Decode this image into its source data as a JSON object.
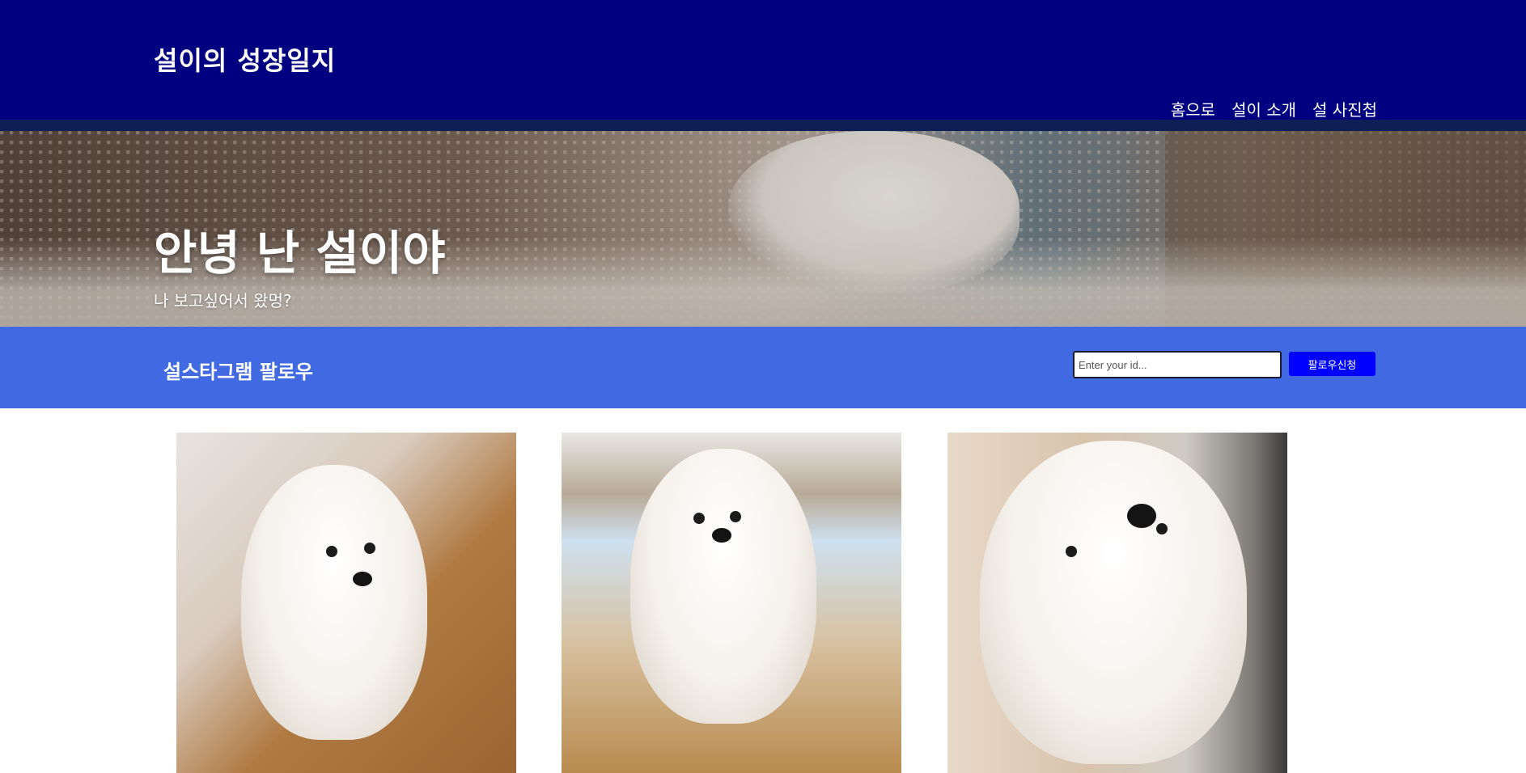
{
  "header": {
    "site_title": "설이의 성장일지",
    "nav": [
      "홈으로",
      "설이 소개",
      "설 사진첩"
    ]
  },
  "hero": {
    "title": "안녕 난 설이야",
    "subtitle": "나 보고싶어서 왔멍?"
  },
  "follow": {
    "title": "설스타그램 팔로우",
    "input_placeholder": "Enter your id...",
    "button_label": "팔로우신청"
  },
  "gallery": {
    "photos": [
      "white-puppy-sitting-photo",
      "white-puppy-smiling-photo",
      "white-dog-looking-up-photo"
    ]
  },
  "colors": {
    "header_bg": "#000080",
    "follow_bar_bg": "#4169e1",
    "button_bg": "#0000ff"
  }
}
